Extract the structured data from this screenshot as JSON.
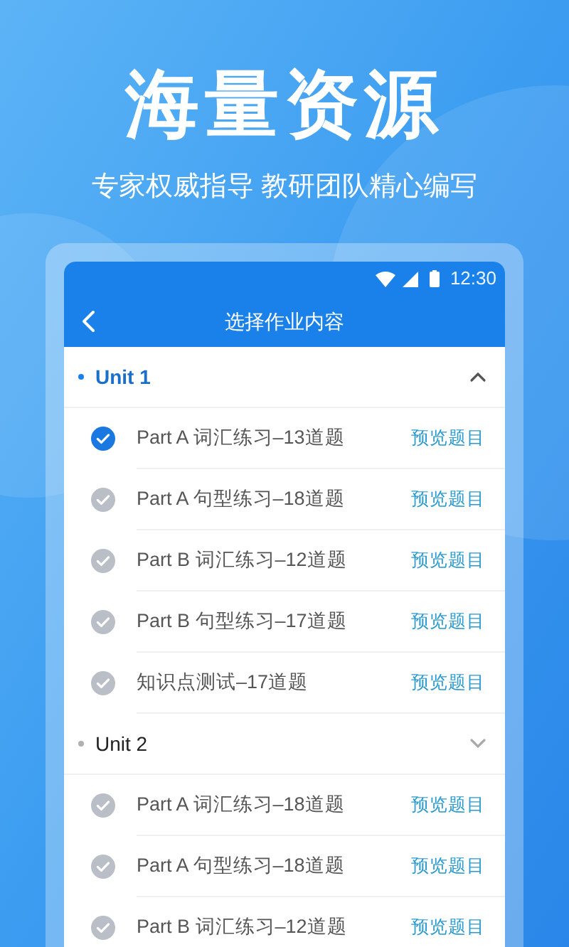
{
  "headline": "海量资源",
  "tagline": "专家权威指导 教研团队精心编写",
  "phone": {
    "status_bar": {
      "time": "12:30"
    },
    "title": "选择作业内容",
    "units": [
      {
        "title": "Unit 1",
        "expanded": true,
        "items": [
          {
            "label": "Part A 词汇练习–13道题",
            "checked": true,
            "action": "预览题目"
          },
          {
            "label": "Part A 句型练习–18道题",
            "checked": false,
            "action": "预览题目"
          },
          {
            "label": "Part B 词汇练习–12道题",
            "checked": false,
            "action": "预览题目"
          },
          {
            "label": "Part B 句型练习–17道题",
            "checked": false,
            "action": "预览题目"
          },
          {
            "label": "知识点测试–17道题",
            "checked": false,
            "action": "预览题目"
          }
        ]
      },
      {
        "title": "Unit 2",
        "expanded": false,
        "items": [
          {
            "label": "Part A 词汇练习–18道题",
            "checked": false,
            "action": "预览题目"
          },
          {
            "label": "Part A 句型练习–18道题",
            "checked": false,
            "action": "预览题目"
          },
          {
            "label": "Part B 词汇练习–12道题",
            "checked": false,
            "action": "预览题目"
          }
        ]
      }
    ]
  }
}
